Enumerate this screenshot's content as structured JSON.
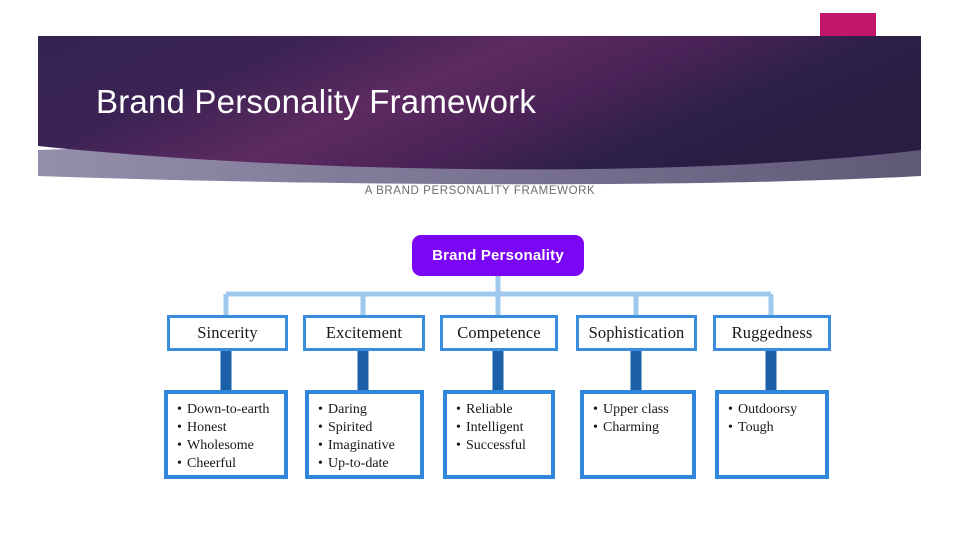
{
  "slide": {
    "title": "Brand Personality Framework",
    "background": "#ffffff",
    "banner": {
      "color_dark": "#2b1f48",
      "color_mid": "#5c2a5e",
      "color_accent_pink": "#c2156c",
      "color_shadow": "#6c6486"
    }
  },
  "diagram": {
    "caption": "A BRAND PERSONALITY FRAMEWORK",
    "root": {
      "label": "Brand Personality",
      "fill": "#7a06f5",
      "text_color": "#ffffff"
    },
    "connector_color_light": "#9ec8ec",
    "connector_color_dark": "#1a5fa8",
    "box_border_color": "#3a8ddd",
    "categories": [
      {
        "label": "Sincerity",
        "traits": [
          "Down-to-earth",
          "Honest",
          "Wholesome",
          "Cheerful"
        ]
      },
      {
        "label": "Excitement",
        "traits": [
          "Daring",
          "Spirited",
          "Imaginative",
          "Up-to-date"
        ]
      },
      {
        "label": "Competence",
        "traits": [
          "Reliable",
          "Intelligent",
          "Successful"
        ]
      },
      {
        "label": "Sophistication",
        "traits": [
          "Upper class",
          "Charming"
        ]
      },
      {
        "label": "Ruggedness",
        "traits": [
          "Outdoorsy",
          "Tough"
        ]
      }
    ]
  }
}
